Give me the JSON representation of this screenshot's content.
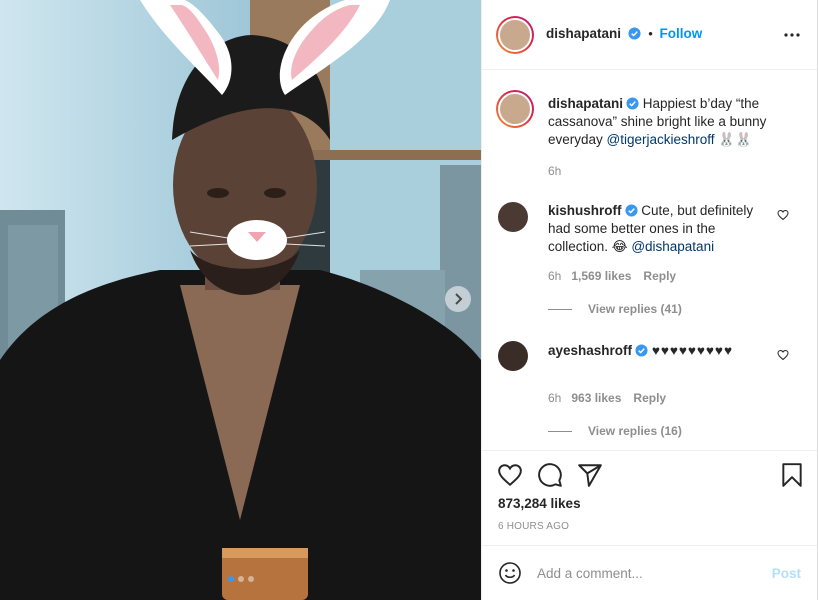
{
  "post": {
    "author": "dishapatani",
    "follow_separator": "•",
    "follow_label": "Follow",
    "verified": true
  },
  "caption": {
    "author": "dishapatani",
    "text": "Happiest b’day “the cassanova” shine bright like a bunny everyday ",
    "mention": "@tigerjackieshroff",
    "trailing": " 🐰🐰",
    "time": "6h"
  },
  "comments": [
    {
      "author": "kishushroff",
      "text": "Cute, but definitely had some better ones in the collection. 😂 ",
      "mention": "@dishapatani",
      "time": "6h",
      "likes": "1,569 likes",
      "reply_label": "Reply",
      "view_replies": "View replies (41)"
    },
    {
      "author": "ayeshashroff",
      "text": "♥♥♥♥♥♥♥♥♥",
      "mention": "",
      "time": "6h",
      "likes": "963 likes",
      "reply_label": "Reply",
      "view_replies": "View replies (16)"
    }
  ],
  "stats": {
    "likes": "873,284 likes",
    "time_ago": "6 HOURS AGO"
  },
  "composer": {
    "placeholder": "Add a comment...",
    "post_label": "Post"
  },
  "carousel": {
    "slide_count": 3,
    "active_index": 0
  },
  "icons": {
    "like": "heart-icon",
    "comment": "comment-bubble-icon",
    "share": "paper-plane-icon",
    "save": "bookmark-icon",
    "emoji": "smiley-icon",
    "more": "ellipsis-icon",
    "next": "chevron-right-icon",
    "verified": "verified-badge-icon"
  },
  "colors": {
    "link": "#0095f6",
    "mention": "#00376b",
    "muted": "#8e8e8e",
    "post_disabled": "#b2dffc",
    "verified": "#3897f0"
  }
}
